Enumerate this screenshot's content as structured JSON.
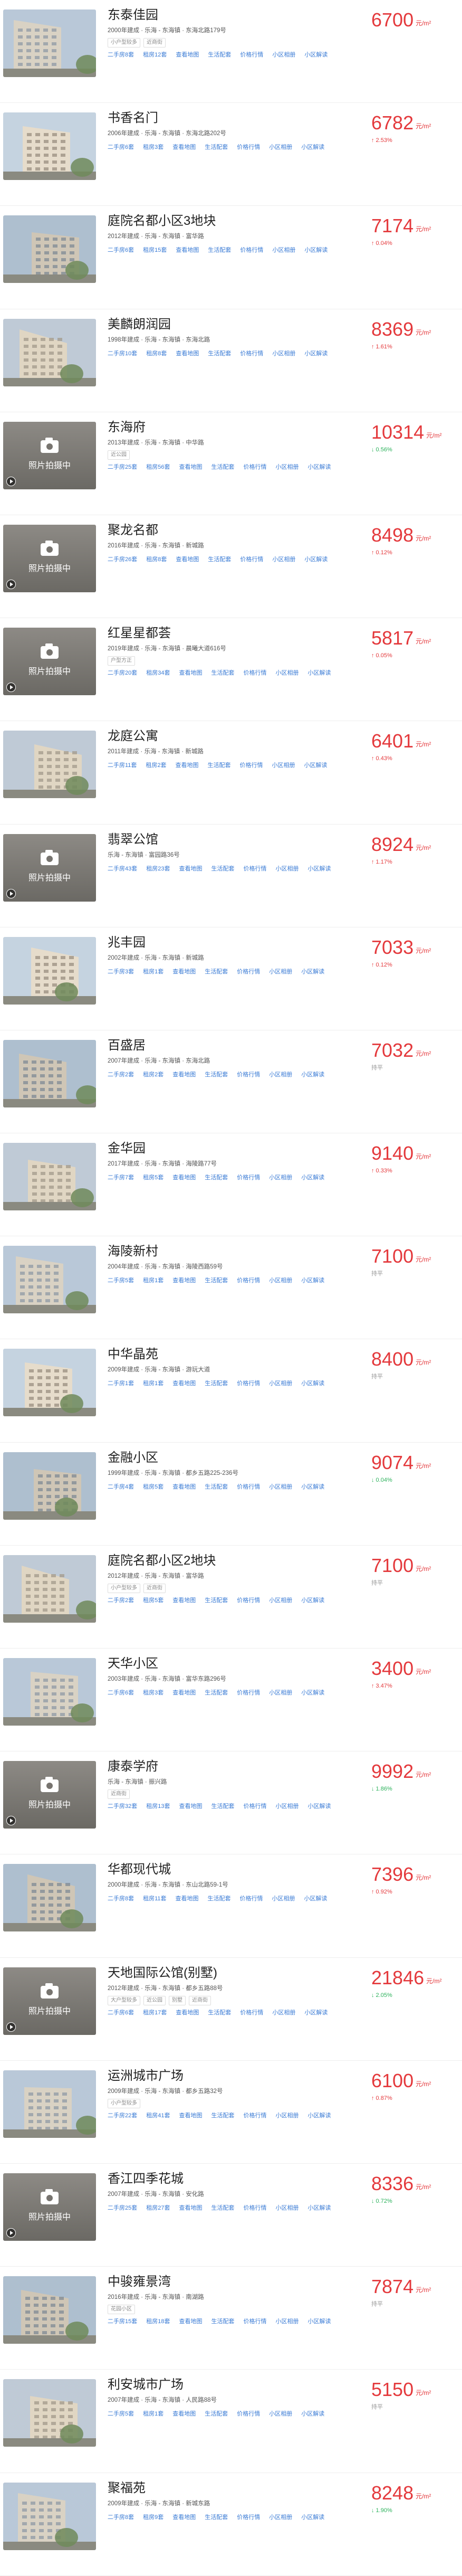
{
  "ui": {
    "photo_placeholder": "照片拍摄中",
    "price_unit": "元/m²",
    "link_labels": [
      "二手房",
      "租房",
      "查看地图",
      "生活配套",
      "价格行情",
      "小区相册",
      "小区解读"
    ],
    "colors": {
      "price": "#e4393c",
      "up": "#e4393c",
      "down": "#2db25c",
      "link": "#3a7bd5"
    }
  },
  "communities": [
    {
      "name": "东泰佳园",
      "meta": "2000年建成 · 乐海 - 东海镇 · 东海北路179号",
      "tags": [
        "小户型较多",
        "近商街"
      ],
      "links": [
        "二手房8套",
        "租房12套"
      ],
      "price": "6700",
      "change": "",
      "change_dir": "flat",
      "photo": "building"
    },
    {
      "name": "书香名门",
      "meta": "2006年建成 · 乐海 - 东海镇 · 东海北路202号",
      "tags": [],
      "links": [
        "二手房6套",
        "租房3套"
      ],
      "price": "6782",
      "change": "↑ 2.53%",
      "change_dir": "up",
      "photo": "building"
    },
    {
      "name": "庭院名都小区3地块",
      "meta": "2012年建成 · 乐海 - 东海镇 · 富华路",
      "tags": [],
      "links": [
        "二手房6套",
        "租房15套"
      ],
      "price": "7174",
      "change": "↑ 0.04%",
      "change_dir": "up",
      "photo": "building"
    },
    {
      "name": "美麟朗润园",
      "meta": "1998年建成 · 乐海 - 东海镇 · 东海北路",
      "tags": [],
      "links": [
        "二手房10套",
        "租房8套"
      ],
      "price": "8369",
      "change": "↑ 1.61%",
      "change_dir": "up",
      "photo": "building"
    },
    {
      "name": "东海府",
      "meta": "2013年建成 · 乐海 - 东海镇 · 中华路",
      "tags": [
        "近公园"
      ],
      "links": [
        "二手房25套",
        "租房56套"
      ],
      "price": "10314",
      "change": "↓ 0.56%",
      "change_dir": "down",
      "photo": "placeholder"
    },
    {
      "name": "聚龙名都",
      "meta": "2016年建成 · 乐海 - 东海镇 · 新城路",
      "tags": [],
      "links": [
        "二手房26套",
        "租房8套"
      ],
      "price": "8498",
      "change": "↑ 0.12%",
      "change_dir": "up",
      "photo": "placeholder"
    },
    {
      "name": "红星星都荟",
      "meta": "2019年建成 · 乐海 - 东海镇 · 晨曦大道616号",
      "tags": [
        "户型方正"
      ],
      "links": [
        "二手房20套",
        "租房34套"
      ],
      "price": "5817",
      "change": "↑ 0.05%",
      "change_dir": "up",
      "photo": "placeholder"
    },
    {
      "name": "龙庭公寓",
      "meta": "2011年建成 · 乐海 - 东海镇 · 新城路",
      "tags": [],
      "links": [
        "二手房11套",
        "租房2套"
      ],
      "price": "6401",
      "change": "↑ 0.43%",
      "change_dir": "up",
      "photo": "building"
    },
    {
      "name": "翡翠公馆",
      "meta": "乐海 - 东海镇 · 富园路36号",
      "tags": [],
      "links": [
        "二手房43套",
        "租房23套"
      ],
      "price": "8924",
      "change": "↑ 1.17%",
      "change_dir": "up",
      "photo": "placeholder"
    },
    {
      "name": "兆丰园",
      "meta": "2002年建成 · 乐海 - 东海镇 · 新城路",
      "tags": [],
      "links": [
        "二手房3套",
        "租房1套"
      ],
      "price": "7033",
      "change": "↑ 0.12%",
      "change_dir": "up",
      "photo": "building"
    },
    {
      "name": "百盛居",
      "meta": "2007年建成 · 乐海 - 东海镇 · 东海北路",
      "tags": [],
      "links": [
        "二手房2套",
        "租房2套"
      ],
      "price": "7032",
      "change": "持平",
      "change_dir": "flat",
      "photo": "building"
    },
    {
      "name": "金华园",
      "meta": "2017年建成 · 乐海 - 东海镇 · 海陵路77号",
      "tags": [],
      "links": [
        "二手房7套",
        "租房5套"
      ],
      "price": "9140",
      "change": "↑ 0.33%",
      "change_dir": "up",
      "photo": "building"
    },
    {
      "name": "海陵新村",
      "meta": "2004年建成 · 乐海 - 东海镇 · 海陵西路59号",
      "tags": [],
      "links": [
        "二手房5套",
        "租房1套"
      ],
      "price": "7100",
      "change": "持平",
      "change_dir": "flat",
      "photo": "building"
    },
    {
      "name": "中华晶苑",
      "meta": "2009年建成 · 乐海 - 东海镇 · 游玩大道",
      "tags": [],
      "links": [
        "二手房1套",
        "租房1套"
      ],
      "price": "8400",
      "change": "持平",
      "change_dir": "flat",
      "photo": "building"
    },
    {
      "name": "金融小区",
      "meta": "1999年建成 · 乐海 - 东海镇 · 都乡五路225-236号",
      "tags": [],
      "links": [
        "二手房4套",
        "租房5套"
      ],
      "price": "9074",
      "change": "↓ 0.04%",
      "change_dir": "down",
      "photo": "building"
    },
    {
      "name": "庭院名都小区2地块",
      "meta": "2012年建成 · 乐海 - 东海镇 · 富华路",
      "tags": [
        "小户型较多",
        "近商街"
      ],
      "links": [
        "二手房2套",
        "租房5套"
      ],
      "price": "7100",
      "change": "持平",
      "change_dir": "flat",
      "photo": "building"
    },
    {
      "name": "天华小区",
      "meta": "2003年建成 · 乐海 - 东海镇 · 富华东路296号",
      "tags": [],
      "links": [
        "二手房6套",
        "租房3套"
      ],
      "price": "3400",
      "change": "↑ 3.47%",
      "change_dir": "up",
      "photo": "building"
    },
    {
      "name": "康泰学府",
      "meta": "乐海 - 东海镇 · 振兴路",
      "tags": [
        "近商街"
      ],
      "links": [
        "二手房32套",
        "租房13套"
      ],
      "price": "9992",
      "change": "↓ 1.86%",
      "change_dir": "down",
      "photo": "placeholder"
    },
    {
      "name": "华都现代城",
      "meta": "2000年建成 · 乐海 - 东海镇 · 东山北路59-1号",
      "tags": [],
      "links": [
        "二手房8套",
        "租房11套"
      ],
      "price": "7396",
      "change": "↑ 0.92%",
      "change_dir": "up",
      "photo": "building"
    },
    {
      "name": "天地国际公馆(别墅)",
      "meta": "2012年建成 · 乐海 - 东海镇 · 都乡五路88号",
      "tags": [
        "大户型较多",
        "近公园",
        "别墅",
        "近商街"
      ],
      "links": [
        "二手房6套",
        "租房17套"
      ],
      "price": "21846",
      "change": "↓ 2.05%",
      "change_dir": "down",
      "photo": "placeholder"
    },
    {
      "name": "运洲城市广场",
      "meta": "2009年建成 · 乐海 - 东海镇 · 都乡五路32号",
      "tags": [
        "小户型较多"
      ],
      "links": [
        "二手房22套",
        "租房41套"
      ],
      "price": "6100",
      "change": "↑ 0.87%",
      "change_dir": "up",
      "photo": "building"
    },
    {
      "name": "香江四季花城",
      "meta": "2007年建成 · 乐海 - 东海镇 · 安化路",
      "tags": [],
      "links": [
        "二手房25套",
        "租房27套"
      ],
      "price": "8336",
      "change": "↓ 0.72%",
      "change_dir": "down",
      "photo": "placeholder"
    },
    {
      "name": "中骏雍景湾",
      "meta": "2016年建成 · 乐海 - 东海镇 · 南湖路",
      "tags": [
        "花园小区"
      ],
      "links": [
        "二手房15套",
        "租房18套"
      ],
      "price": "7874",
      "change": "持平",
      "change_dir": "flat",
      "photo": "building"
    },
    {
      "name": "利安城市广场",
      "meta": "2007年建成 · 乐海 - 东海镇 · 人民路88号",
      "tags": [],
      "links": [
        "二手房5套",
        "租房1套"
      ],
      "price": "5150",
      "change": "持平",
      "change_dir": "flat",
      "photo": "building"
    },
    {
      "name": "聚福苑",
      "meta": "2009年建成 · 乐海 - 东海镇 · 新城东路",
      "tags": [],
      "links": [
        "二手房8套",
        "租房9套"
      ],
      "price": "8248",
      "change": "↓ 1.90%",
      "change_dir": "down",
      "photo": "building"
    }
  ]
}
